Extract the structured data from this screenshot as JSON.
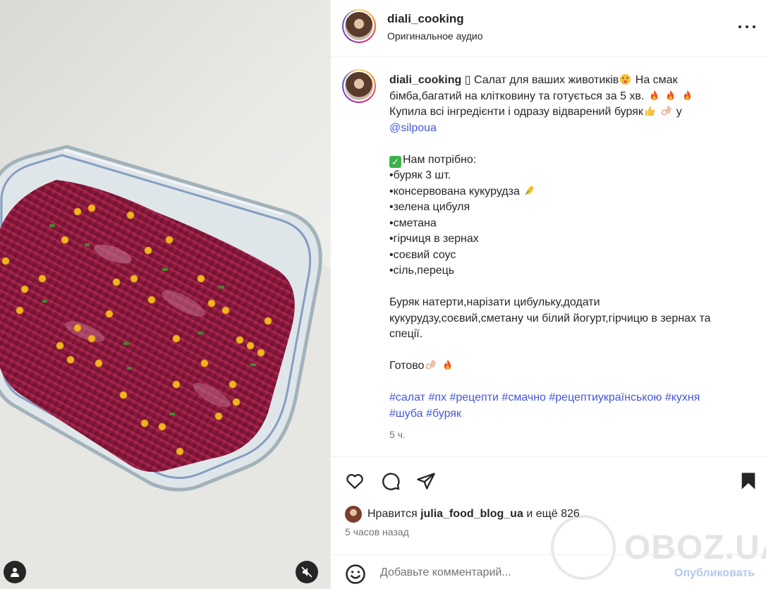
{
  "post": {
    "username": "diali_cooking",
    "audio": "Оригинальное аудио"
  },
  "caption": {
    "username": "diali_cooking",
    "square_glyph": "▯",
    "l1": "Салат для ваших животиків",
    "l1b": "На смак",
    "l2": "бімба,багатий на клітковину та готується за 5 хв.",
    "l3": "Купила всі інгредієнти і одразу відварений буряк",
    "l3b": "у",
    "mention": "@silpoua",
    "need_title": "Нам потрібно:",
    "ingredients": [
      "•буряк 3 шт.",
      "•консервована кукурудза",
      "•зелена цибуля",
      "•сметана",
      "•гірчиця в зернах",
      "•соєвий соус",
      "•сіль,перець"
    ],
    "method_1": "Буряк натерти,нарізати цибульку,додати",
    "method_2": "кукурудзу,соєвий,сметану чи білий йогурт,гірчицю в зернах та",
    "method_3": "спеції.",
    "ready": "Готово",
    "hashtags_1": "#салат #пх #рецепти #смачно #рецептиукраїнською #кухня",
    "hashtags_2": "#шуба #буряк",
    "time": "5 ч."
  },
  "likes": {
    "prefix": "Нравится",
    "user": "julia_food_blog_ua",
    "suffix": "и ещё 826"
  },
  "ago": "5 часов назад",
  "comment": {
    "placeholder": "Добавьте комментарий...",
    "publish": "Опубликовать"
  },
  "watermark": "OBOZ.UA",
  "icons": {
    "like": "heart-icon",
    "comment": "comment-icon",
    "share": "send-icon",
    "save": "bookmark-icon",
    "more": "more-icon",
    "emoji": "smile-icon",
    "user": "user-icon",
    "mute": "mute-icon"
  },
  "colors": {
    "link": "#4557d8",
    "publish_disabled": "#b3c8ef",
    "secondary_text": "#737373",
    "beet": "#9c1d45"
  }
}
